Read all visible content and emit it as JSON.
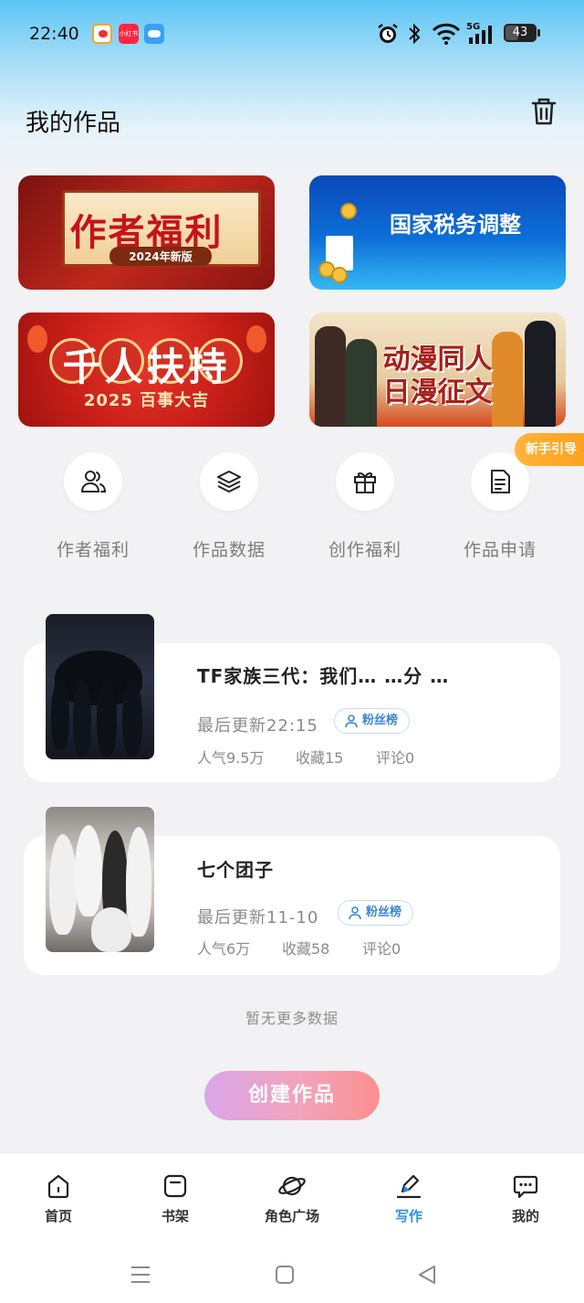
{
  "status_bar": {
    "time": "22:40",
    "xhs_label": "小红书",
    "battery": "43",
    "network": "5G",
    "icons": [
      "weibo-icon",
      "xiaohongshu-icon",
      "weather-icon",
      "alarm-icon",
      "bluetooth-icon",
      "wifi-icon",
      "signal-icon",
      "battery-icon"
    ]
  },
  "header": {
    "title": "我的作品",
    "trash_icon": "trash-icon"
  },
  "banners": [
    {
      "title": "作者福利",
      "subtitle": "2024年新版"
    },
    {
      "title": "国家税务调整"
    },
    {
      "title": "千人扶持",
      "subtitle": "2025 百事大吉"
    },
    {
      "title": "动漫同人",
      "subtitle": "日漫征文"
    }
  ],
  "quick_actions": [
    {
      "label": "作者福利",
      "icon": "users-icon"
    },
    {
      "label": "作品数据",
      "icon": "layers-icon"
    },
    {
      "label": "创作福利",
      "icon": "gift-icon"
    },
    {
      "label": "作品申请",
      "icon": "document-icon"
    }
  ],
  "guide_tag": "新手引导",
  "works": [
    {
      "title": "TF家族三代：我们… …分 …",
      "updated": "最后更新22:15",
      "tag": "粉丝榜",
      "popularity": "人气9.5万",
      "favorites": "收藏15",
      "comments": "评论0"
    },
    {
      "title": "七个团子",
      "updated": "最后更新11-10",
      "tag": "粉丝榜",
      "popularity": "人气6万",
      "favorites": "收藏58",
      "comments": "评论0"
    }
  ],
  "no_more": "暂无更多数据",
  "create_button": "创建作品",
  "bottom_nav": [
    {
      "label": "首页",
      "icon": "home-icon"
    },
    {
      "label": "书架",
      "icon": "bookshelf-icon"
    },
    {
      "label": "角色广场",
      "icon": "planet-icon"
    },
    {
      "label": "写作",
      "icon": "write-icon",
      "active": true
    },
    {
      "label": "我的",
      "icon": "chat-bubble-icon"
    }
  ],
  "colors": {
    "accent": "#2f8fe6",
    "guide": "#ffa01c",
    "create_start": "#d8a6e8",
    "create_end": "#fb8f8f"
  }
}
